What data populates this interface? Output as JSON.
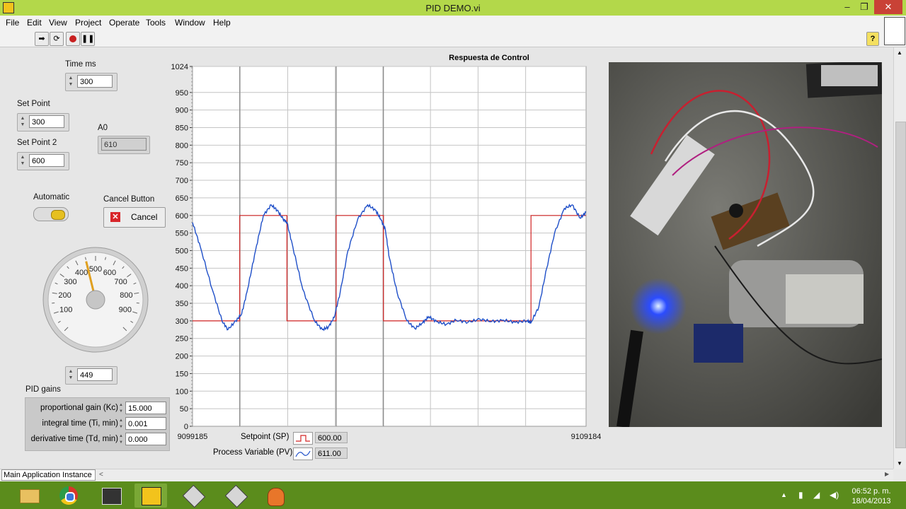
{
  "window": {
    "title": "PID DEMO.vi",
    "controls": {
      "minimize": "–",
      "restore": "❐",
      "close": "✕"
    }
  },
  "menu": [
    "File",
    "Edit",
    "View",
    "Project",
    "Operate",
    "Tools",
    "Window",
    "Help"
  ],
  "toolbar": {
    "run_icon": "run-arrow-icon",
    "continuous_icon": "run-continuously-icon",
    "abort_icon": "abort-icon",
    "pause_icon": "pause-icon",
    "help_glyph": "?"
  },
  "controls": {
    "time_ms": {
      "label": "Time ms",
      "value": "300"
    },
    "set_point": {
      "label": "Set Point",
      "value": "300"
    },
    "set_point_2": {
      "label": "Set Point 2",
      "value": "600"
    },
    "a0": {
      "label": "A0",
      "value": "610"
    },
    "automatic": {
      "label": "Automatic"
    },
    "cancel": {
      "label": "Cancel Button",
      "button_text": "Cancel"
    },
    "gauge": {
      "min": 0,
      "max": 1000,
      "value": 449,
      "ticks": [
        "100",
        "200",
        "300",
        "400",
        "500",
        "600",
        "700",
        "800",
        "900"
      ]
    },
    "gauge_readout": {
      "value": "449"
    }
  },
  "pid": {
    "title": "PID gains",
    "rows": [
      {
        "label": "proportional gain (Kc)",
        "value": "15.000"
      },
      {
        "label": "integral time (Ti, min)",
        "value": "0.001"
      },
      {
        "label": "derivative time (Td, min)",
        "value": "0.000"
      }
    ]
  },
  "legend": {
    "sp": {
      "label": "Setpoint (SP)",
      "value": "600.00"
    },
    "pv": {
      "label": "Process Variable (PV)",
      "value": "611.00"
    }
  },
  "chart_data": {
    "type": "line",
    "title": "Respuesta de Control",
    "xlim": [
      9099185,
      9109184
    ],
    "x_tick_labels": [
      "9099185",
      "9109184"
    ],
    "ylim": [
      0,
      1024
    ],
    "y_ticks": [
      "0",
      "50",
      "100",
      "150",
      "200",
      "250",
      "300",
      "350",
      "400",
      "450",
      "500",
      "550",
      "600",
      "650",
      "700",
      "750",
      "800",
      "850",
      "900",
      "950",
      "1024"
    ],
    "grid": true,
    "colors": {
      "sp": "#d22424",
      "pv": "#1f4fc8",
      "grid": "#c4c4c4",
      "marker": "#8a8a8a"
    },
    "series": [
      {
        "name": "Setpoint (SP)",
        "x": [
          0,
          0.12,
          0.12,
          0.24,
          0.24,
          0.365,
          0.365,
          0.485,
          0.485,
          0.86,
          0.86,
          1.0
        ],
        "values": [
          300,
          300,
          600,
          600,
          300,
          300,
          600,
          600,
          300,
          300,
          600,
          600
        ]
      },
      {
        "name": "Process Variable (PV)",
        "x": [
          0,
          0.02,
          0.05,
          0.075,
          0.09,
          0.11,
          0.125,
          0.14,
          0.16,
          0.18,
          0.2,
          0.215,
          0.23,
          0.24,
          0.255,
          0.28,
          0.31,
          0.33,
          0.345,
          0.36,
          0.375,
          0.395,
          0.42,
          0.445,
          0.465,
          0.478,
          0.49,
          0.5,
          0.52,
          0.545,
          0.565,
          0.585,
          0.6,
          0.62,
          0.645,
          0.67,
          0.7,
          0.73,
          0.76,
          0.79,
          0.82,
          0.85,
          0.86,
          0.88,
          0.9,
          0.92,
          0.945,
          0.965,
          0.985,
          1.0
        ],
        "values": [
          580,
          510,
          390,
          300,
          275,
          300,
          320,
          390,
          500,
          600,
          630,
          615,
          590,
          580,
          510,
          390,
          300,
          275,
          282,
          310,
          380,
          500,
          590,
          630,
          615,
          590,
          560,
          480,
          380,
          300,
          278,
          295,
          312,
          298,
          290,
          302,
          296,
          305,
          298,
          302,
          296,
          300,
          295,
          340,
          450,
          550,
          620,
          630,
          592,
          610
        ]
      }
    ],
    "markers_x": [
      0.12,
      0.365,
      0.485
    ]
  },
  "status": {
    "instance": "Main Application Instance"
  },
  "taskbar": {
    "apps": [
      "explorer-icon",
      "chrome-icon",
      "labview-project-icon",
      "labview-vi-icon",
      "labview-icon-2",
      "labview-icon-3",
      "hand-tool-icon"
    ],
    "time": "06:52 p. m.",
    "date": "18/04/2013"
  }
}
